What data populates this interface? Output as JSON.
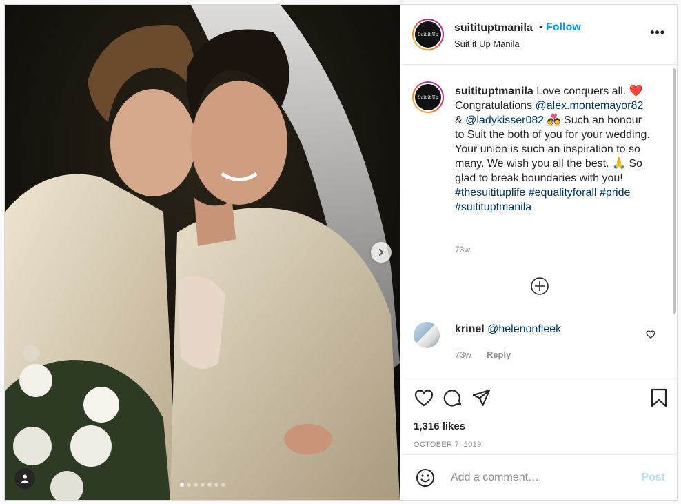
{
  "header": {
    "username": "suitituptmanila",
    "separator": "•",
    "follow_label": "Follow",
    "subtitle": "Suit it Up Manila",
    "avatar_text": "Suit it Up",
    "more_icon": "more-horizontal-icon"
  },
  "caption": {
    "username": "suitituptmanila",
    "text_1": " Love conquers all. ",
    "emoji_heart": "❤️",
    "text_2": " Congratulations ",
    "mention_1": "@alex.montemayor82",
    "text_3": " & ",
    "mention_2": "@ladykisser082",
    "emoji_couple": "💑",
    "text_4": " Such an honour to Suit the both of you for your wedding. Your union is such an inspiration to so many. We wish you all the best. ",
    "emoji_pray": "🙏",
    "text_5": " So glad to break boundaries with you! ",
    "hashtag_1": "#thesuitituplife",
    "hashtag_2": "#equalityforall",
    "hashtag_3": "#pride",
    "hashtag_4": "#suitituptmanila",
    "time": "73w"
  },
  "comment": {
    "username": "krinel",
    "mention": "@helenonfleek",
    "time": "73w",
    "reply_label": "Reply"
  },
  "actions": {
    "likes": "1,316 likes",
    "date": "OCTOBER 7, 2019"
  },
  "add_comment": {
    "placeholder": "Add a comment…",
    "post_label": "Post"
  },
  "carousel": {
    "total": 7,
    "active_index": 0
  },
  "colors": {
    "accent": "#0095f6",
    "link": "#00376b",
    "muted": "#8e8e8e",
    "post_disabled": "#b2dffc"
  }
}
